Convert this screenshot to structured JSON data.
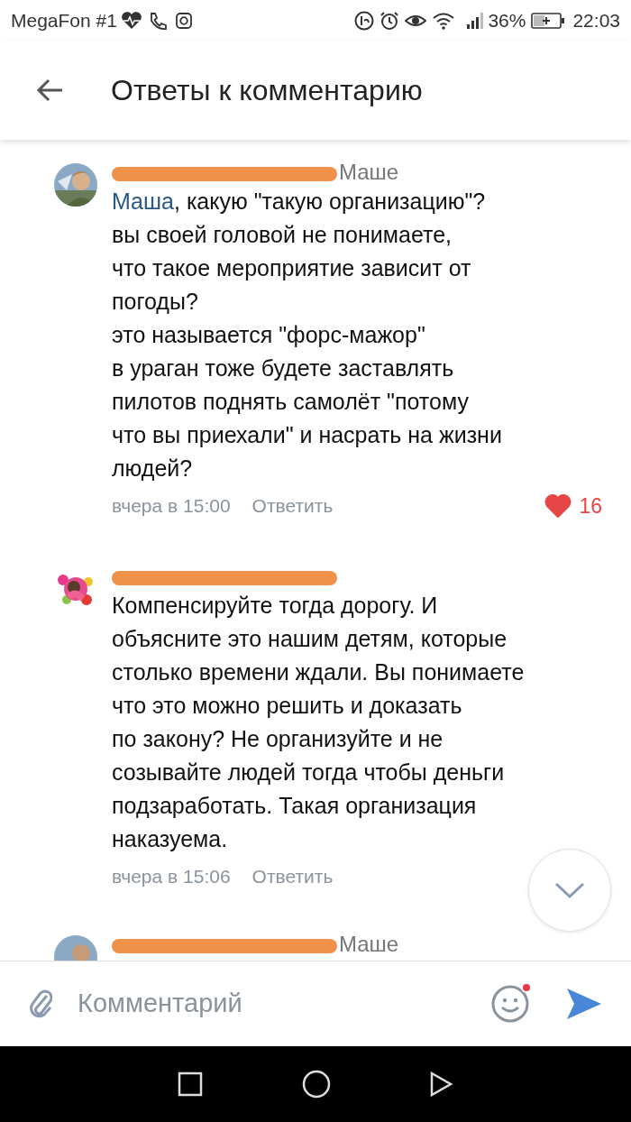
{
  "status_bar": {
    "carrier": "MegaFon #1",
    "battery": "36%",
    "time": "22:03"
  },
  "header": {
    "title": "Ответы к комментарию"
  },
  "comments": [
    {
      "redacted_name": true,
      "reply_to": "Маше",
      "mention": "Маша",
      "lines": [
        ", какую \"такую организацию\"?",
        "вы своей головой не понимаете,",
        "что такое мероприятие зависит от",
        "погоды?",
        "это называется \"форс-мажор\"",
        "в ураган тоже будете заставлять",
        "пилотов поднять самолёт \"потому",
        "что вы приехали\" и насрать на жизни",
        "людей?"
      ],
      "time": "вчера в 15:00",
      "reply": "Ответить",
      "likes": "16",
      "liked": true
    },
    {
      "redacted_name": true,
      "lines": [
        "Компенсируйте тогда дорогу. И",
        "объясните это нашим детям, которые",
        "столько времени ждали. Вы понимаете",
        "что это можно решить и доказать",
        "по закону? Не организуйте и не",
        "созывайте людей тогда чтобы деньги",
        "подзаработать. Такая организация",
        "наказуема."
      ],
      "time": "вчера в 15:06",
      "reply": "Ответить"
    },
    {
      "redacted_name": true,
      "reply_to": "Маше"
    }
  ],
  "composer": {
    "placeholder": "Комментарий",
    "emoji_badge": true
  }
}
